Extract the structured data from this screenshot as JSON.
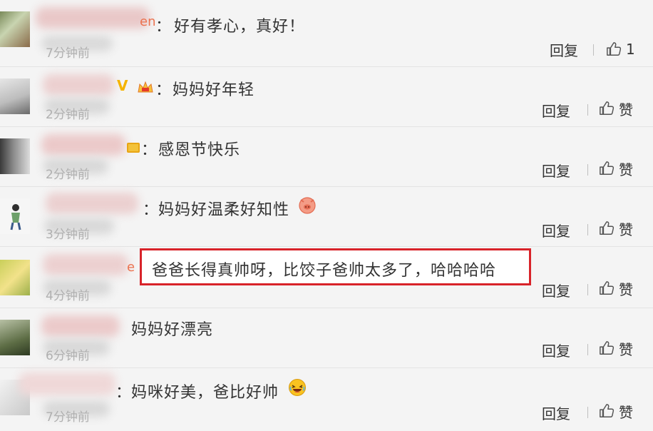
{
  "comments": [
    {
      "nick_tail": "en",
      "text": "好有孝心，真好！",
      "time": "7分钟前",
      "reply": "回复",
      "like": "1"
    },
    {
      "nick_tail": "",
      "text": "妈妈好年轻",
      "time": "2分钟前",
      "reply": "回复",
      "like": "赞"
    },
    {
      "nick_tail": "",
      "text": "感恩节快乐",
      "time": "2分钟前",
      "reply": "回复",
      "like": "赞"
    },
    {
      "nick_tail": "",
      "text": "妈妈好温柔好知性",
      "time": "3分钟前",
      "reply": "回复",
      "like": "赞"
    },
    {
      "nick_tail": "e",
      "text": "爸爸长得真帅呀，比饺子爸帅太多了，哈哈哈哈",
      "time": "4分钟前",
      "reply": "回复",
      "like": "赞"
    },
    {
      "nick_tail": "",
      "text": "妈妈好漂亮",
      "time": "6分钟前",
      "reply": "回复",
      "like": "赞"
    },
    {
      "nick_tail": "",
      "text": "妈咪好美，爸比好帅",
      "time": "7分钟前",
      "reply": "回复",
      "like": "赞"
    }
  ],
  "colon": "：",
  "colors": {
    "highlight_border": "#d8232a",
    "nickname": "#eb7350",
    "background": "#f4f4f4"
  },
  "icons": {
    "like": "thumbs-up-icon",
    "vip": "vip-v-icon",
    "crown": "crown-badge-icon",
    "medal": "medal-badge-icon",
    "emoji_pig": "pig-emoji-icon",
    "emoji_laugh": "laugh-emoji-icon"
  }
}
